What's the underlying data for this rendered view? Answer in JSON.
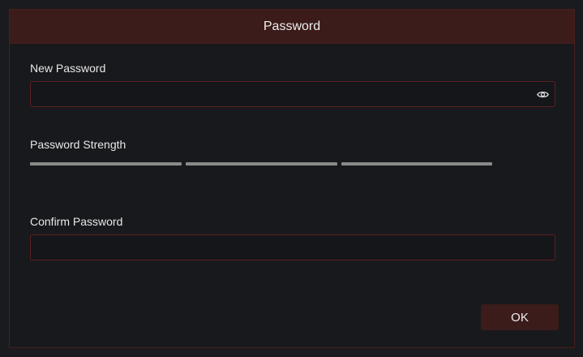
{
  "dialog": {
    "title": "Password",
    "new_password": {
      "label": "New Password",
      "value": "",
      "placeholder": "",
      "toggle_icon": "eye-icon"
    },
    "strength": {
      "label": "Password Strength",
      "segments": 3,
      "level": 0,
      "segment_color": "#8a8a8a"
    },
    "confirm_password": {
      "label": "Confirm Password",
      "value": "",
      "placeholder": ""
    },
    "ok_label": "OK"
  },
  "colors": {
    "accent": "#3b1c1b",
    "border": "#5d2121",
    "background": "#18191c"
  }
}
